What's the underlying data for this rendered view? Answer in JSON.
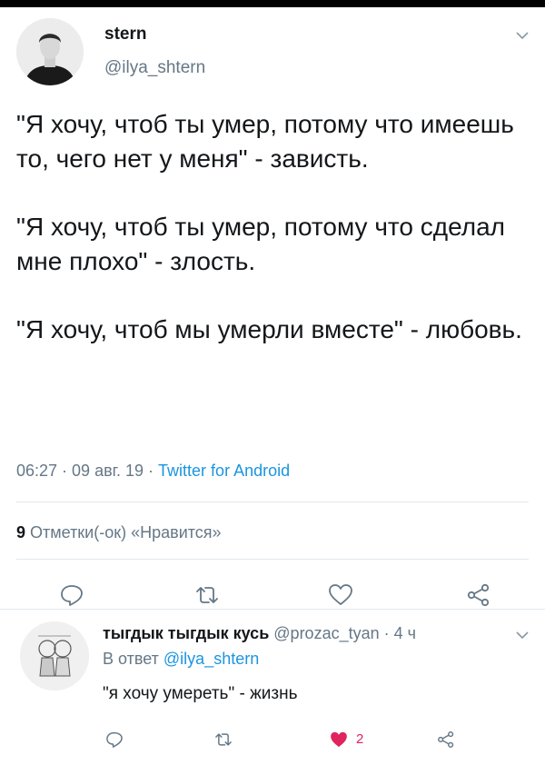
{
  "tweet": {
    "author_name": "stern",
    "author_handle": "@ilya_shtern",
    "paragraphs": [
      "\"Я хочу, чтоб ты умер, потому что имеешь то, чего нет у меня\" - зависть.",
      "\"Я хочу, чтоб ты умер, потому что сделал мне плохо\" - злость.",
      "\"Я хочу, чтоб мы умерли вместе\" - любовь."
    ],
    "time": "06:27",
    "date": "09 авг. 19",
    "source": "Twitter for Android",
    "separator": " · ",
    "likes_count": "9",
    "likes_label": "Отметки(-ок) «Нравится»"
  },
  "reply": {
    "author_name": "тыгдык тыгдык кусь",
    "author_handle": "@prozac_tyan",
    "time": "· 4 ч",
    "reply_to_prefix": "В ответ",
    "reply_to_handle": "@ilya_shtern",
    "text": "\"я хочу умереть\" - жизнь",
    "like_count": "2"
  },
  "colors": {
    "text": "#14171a",
    "secondary": "#657786",
    "link": "#1b95e0",
    "like": "#e0245e",
    "divider": "#e1e8ed"
  },
  "icons": {
    "reply": "speech-bubble-icon",
    "retweet": "retweet-icon",
    "like": "heart-icon",
    "share": "share-icon",
    "more": "chevron-down-icon"
  }
}
